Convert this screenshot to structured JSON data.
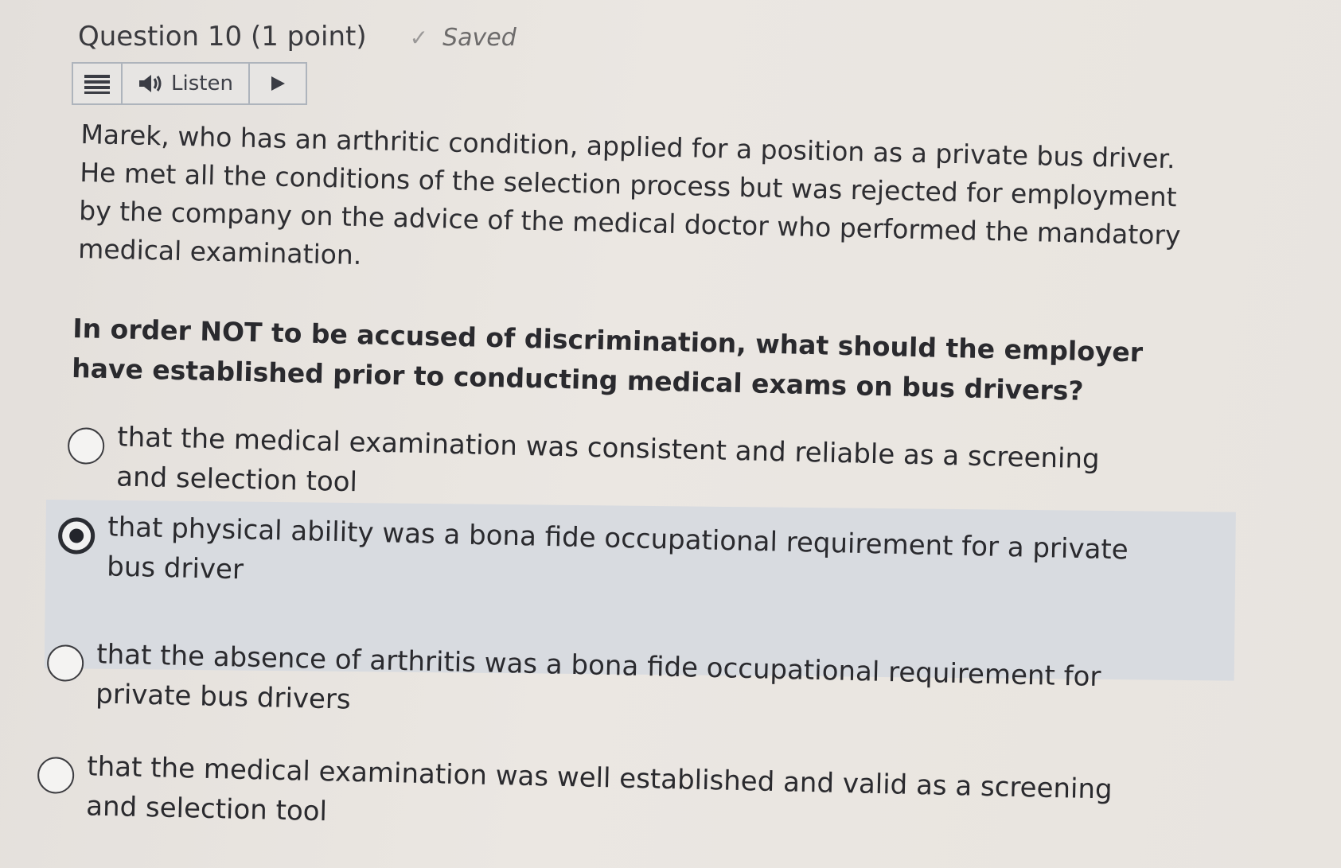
{
  "question": {
    "title": "Question 10 (1 point)",
    "status_icon": "checkmark-icon",
    "status_text": "Saved"
  },
  "toolbar": {
    "menu_icon": "hamburger-menu-icon",
    "listen_icon": "speaker-icon",
    "listen_label": "Listen",
    "play_icon": "play-icon"
  },
  "passage": "Marek, who has an arthritic condition, applied for a position as a private bus driver. He met all the conditions of the selection process but was rejected for employment by the company on the advice of the medical doctor who performed the mandatory medical examination.",
  "prompt": "In order NOT to be accused of discrimination, what should the employer have established prior to conducting medical exams on bus drivers?",
  "options": [
    {
      "label": "that the medical examination was consistent and reliable as a screening and selection tool",
      "selected": false
    },
    {
      "label": "that physical ability was a bona fide occupational requirement for a private bus driver",
      "selected": true
    },
    {
      "label": "that the absence of arthritis was a bona fide occupational requirement for private bus drivers",
      "selected": false
    },
    {
      "label": "that the medical examination was well established and valid as a screening and selection tool",
      "selected": false
    }
  ],
  "colors": {
    "selected_highlight": "#d8dbe0",
    "radio_border": "#3c3c40",
    "toolbar_border": "#aeb4bc"
  }
}
